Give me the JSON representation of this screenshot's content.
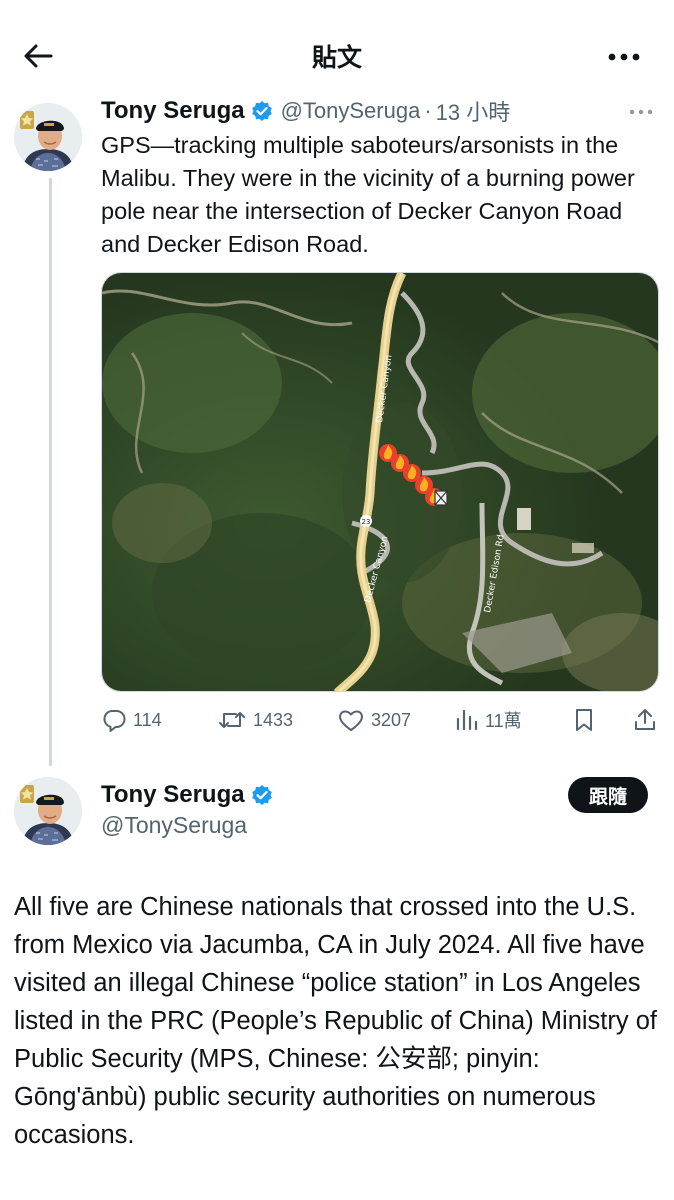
{
  "header": {
    "title": "貼文"
  },
  "tweet_main": {
    "display_name": "Tony Seruga",
    "handle": "@TonySeruga",
    "separator": "·",
    "time": "13 小時",
    "text": "GPS—tracking multiple saboteurs/arsonists in the Malibu. They were in the vicinity of a burning power pole near the intersection of Decker Canyon Road and Decker Edison Road.",
    "map": {
      "road_label_1": "Decker Canyon",
      "road_label_2": "Decker Canyon",
      "road_label_3": "Decker Edison Rd",
      "route_marker": "23",
      "markers": [
        "🔥",
        "🔥",
        "🔥",
        "🔥",
        "🔥"
      ]
    },
    "stats": {
      "replies": "114",
      "reposts": "1433",
      "likes": "3207",
      "views": "11萬"
    }
  },
  "tweet_reply": {
    "display_name": "Tony Seruga",
    "handle": "@TonySeruga",
    "follow_label": "跟隨",
    "text": "All five are Chinese nationals that crossed into the U.S. from Mexico via Jacumba, CA in July 2024. All five have visited an illegal Chinese “police station” in Los Angeles listed in the PRC (People’s Republic of China) Ministry of Public Security (MPS, Chinese: 公安部; pinyin: Gōng'ānbù) public security authorities on numerous occasions."
  },
  "colors": {
    "text_primary": "#0f1419",
    "text_secondary": "#536471",
    "verified_blue": "#1d9bf0",
    "thread_line": "#cfd9de",
    "follow_button": "#0f1419"
  }
}
